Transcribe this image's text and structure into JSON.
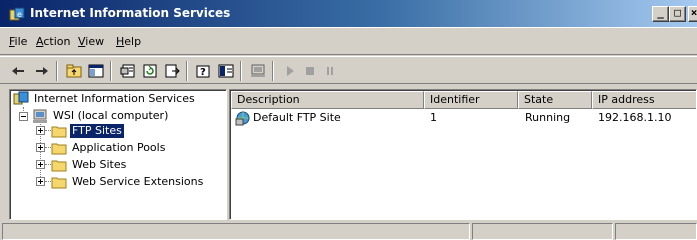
{
  "window": {
    "title": "Internet Information Services",
    "minimize_label": "_",
    "maximize_label": "□",
    "close_label": "×"
  },
  "menu": {
    "items": [
      {
        "label": "File",
        "mnemonic": "F"
      },
      {
        "label": "Action",
        "mnemonic": "A"
      },
      {
        "label": "View",
        "mnemonic": "V"
      },
      {
        "label": "Help",
        "mnemonic": "H"
      }
    ]
  },
  "toolbar": {
    "buttons": [
      {
        "icon": "back-arrow-icon"
      },
      {
        "icon": "forward-arrow-icon"
      },
      {
        "icon": "up-folder-icon"
      },
      {
        "icon": "show-hide-console-tree-icon"
      },
      {
        "icon": "properties-icon"
      },
      {
        "icon": "refresh-icon"
      },
      {
        "icon": "export-list-icon"
      },
      {
        "icon": "help-icon"
      },
      {
        "icon": "console-icon"
      },
      {
        "icon": "computer-icon"
      },
      {
        "icon": "play-icon"
      },
      {
        "icon": "stop-icon"
      },
      {
        "icon": "pause-icon"
      }
    ]
  },
  "tree": {
    "root": {
      "label": "Internet Information Services",
      "icon": "iis-icon"
    },
    "computer": {
      "label": "WSI (local computer)",
      "icon": "computer-icon"
    },
    "children": [
      {
        "label": "FTP Sites",
        "icon": "folder-icon",
        "selected": true
      },
      {
        "label": "Application Pools",
        "icon": "folder-icon",
        "selected": false
      },
      {
        "label": "Web Sites",
        "icon": "folder-icon",
        "selected": false
      },
      {
        "label": "Web Service Extensions",
        "icon": "folder-icon",
        "selected": false
      }
    ]
  },
  "list": {
    "columns": [
      "Description",
      "Identifier",
      "State",
      "IP address"
    ],
    "rows": [
      {
        "description": "Default FTP Site",
        "identifier": "1",
        "state": "Running",
        "ip_address": "192.168.1.10",
        "icon": "ftp-site-icon"
      }
    ]
  },
  "colors": {
    "title_gradient_start": "#0a246a",
    "title_gradient_end": "#a6caf0",
    "window_face": "#d4d0c8",
    "selection": "#0a246a",
    "folder": "#f5d76e"
  }
}
